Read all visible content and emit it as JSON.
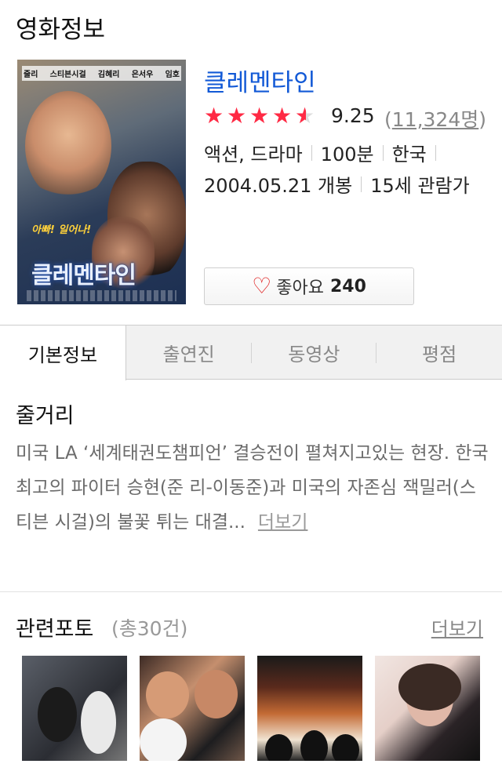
{
  "section_title": "영화정보",
  "poster": {
    "cast": [
      "줄리",
      "스티븐시걸",
      "김혜리",
      "은서우",
      "임호"
    ],
    "tagline": "아빠! 일어나!",
    "title_text": "클레멘타인"
  },
  "movie": {
    "title": "클레멘타인",
    "rating": "9.25",
    "rating_value": 4.6,
    "rating_max": 5,
    "count_open": "(",
    "count": "11,324명",
    "count_close": ")",
    "genre": "액션, 드라마",
    "runtime": "100분",
    "country": "한국",
    "release": "2004.05.21 개봉",
    "age_rating": "15세 관람가"
  },
  "like": {
    "label": "좋아요",
    "count": "240"
  },
  "tabs": [
    {
      "label": "기본정보",
      "active": true
    },
    {
      "label": "출연진",
      "active": false
    },
    {
      "label": "동영상",
      "active": false
    },
    {
      "label": "평점",
      "active": false
    }
  ],
  "synopsis": {
    "title": "줄거리",
    "text": "미국 LA ‘세계태권도챔피언’ 결승전이 펼쳐지고있는 현장. 한국 최고의 파이터 승현(준 리-이동준)과 미국의 자존심 잭밀러(스티븐 시걸)의 불꽃 튀는 대결...",
    "more": "더보기"
  },
  "photos": {
    "title": "관련포토",
    "count": "(총30건)",
    "more": "더보기"
  },
  "colors": {
    "link": "#1259d6",
    "star": "#ff2a44",
    "heart": "#dd1111"
  },
  "icons": {
    "star": "star-icon",
    "heart": "heart-icon"
  }
}
